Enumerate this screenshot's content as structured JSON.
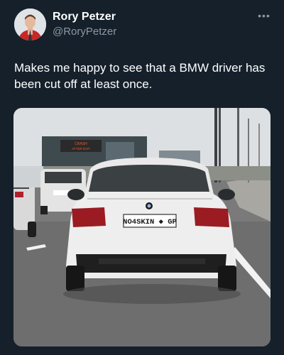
{
  "author": {
    "name": "Rory Petzer",
    "handle": "@RoryPetzer"
  },
  "icons": {
    "avatar": "profile-photo",
    "more": "more-horizontal-icon"
  },
  "more_glyph": "•••",
  "tweet": {
    "text_line1": "Makes me happy to see that a BMW driver has",
    "text_line2": "been cut off at least once."
  },
  "photo": {
    "plate": "NO4SKIN ◆ GP",
    "sign_top": "CRASH",
    "sign_mid": "AFTER EXIT"
  },
  "colors": {
    "background": "#15202b",
    "secondary_text": "#8b98a5",
    "car_body": "#eeeeee"
  }
}
